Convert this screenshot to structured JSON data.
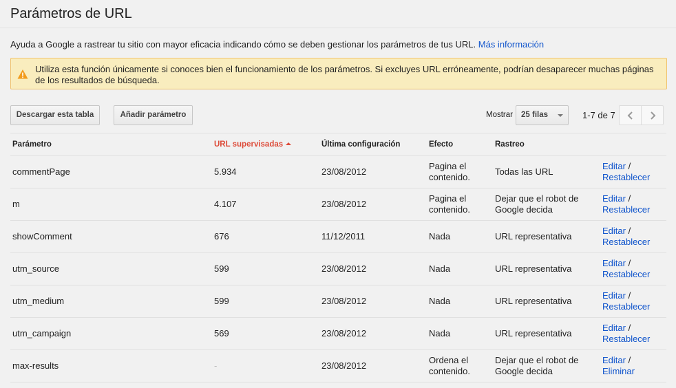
{
  "page": {
    "title": "Parámetros de URL",
    "intro_text": "Ayuda a Google a rastrear tu sitio con mayor eficacia indicando cómo se deben gestionar los parámetros de tus URL.",
    "intro_link": "Más información"
  },
  "warning": {
    "icon": "warning-icon",
    "text": "Utiliza esta función únicamente si conoces bien el funcionamiento de los parámetros. Si excluyes URL erróneamente, podrían desaparecer muchas páginas de los resultados de búsqueda."
  },
  "toolbar": {
    "download_label": "Descargar esta tabla",
    "add_label": "Añadir parámetro",
    "show_label": "Mostrar",
    "rows_selected": "25 filas",
    "pager_text": "1-7 de 7"
  },
  "colors": {
    "link": "#1155cc",
    "sorted_header": "#dd4b39",
    "warning_bg": "#f9edbe",
    "warning_border": "#f0c36d"
  },
  "table": {
    "headers": {
      "param": "Parámetro",
      "urls": "URL supervisadas",
      "date": "Última configuración",
      "effect": "Efecto",
      "crawl": "Rastreo"
    },
    "rows": [
      {
        "param": "commentPage",
        "urls": "5.934",
        "date": "23/08/2012",
        "effect": "Pagina el contenido.",
        "crawl": "Todas las URL",
        "edit": "Editar",
        "sep": " /",
        "reset": "Restablecer"
      },
      {
        "param": "m",
        "urls": "4.107",
        "date": "23/08/2012",
        "effect": "Pagina el contenido.",
        "crawl": "Dejar que el robot de Google decida",
        "edit": "Editar",
        "sep": " /",
        "reset": "Restablecer"
      },
      {
        "param": "showComment",
        "urls": "676",
        "date": "11/12/2011",
        "effect": "Nada",
        "crawl": "URL representativa",
        "edit": "Editar",
        "sep": " /",
        "reset": "Restablecer"
      },
      {
        "param": "utm_source",
        "urls": "599",
        "date": "23/08/2012",
        "effect": "Nada",
        "crawl": "URL representativa",
        "edit": "Editar",
        "sep": " /",
        "reset": "Restablecer"
      },
      {
        "param": "utm_medium",
        "urls": "599",
        "date": "23/08/2012",
        "effect": "Nada",
        "crawl": "URL representativa",
        "edit": "Editar",
        "sep": " /",
        "reset": "Restablecer"
      },
      {
        "param": "utm_campaign",
        "urls": "569",
        "date": "23/08/2012",
        "effect": "Nada",
        "crawl": "URL representativa",
        "edit": "Editar",
        "sep": " /",
        "reset": "Restablecer"
      },
      {
        "param": "max-results",
        "urls": "-",
        "date": "23/08/2012",
        "effect": "Ordena el contenido.",
        "crawl": "Dejar que el robot de Google decida",
        "edit": "Editar",
        "sep": " /",
        "reset": "Eliminar"
      }
    ]
  }
}
